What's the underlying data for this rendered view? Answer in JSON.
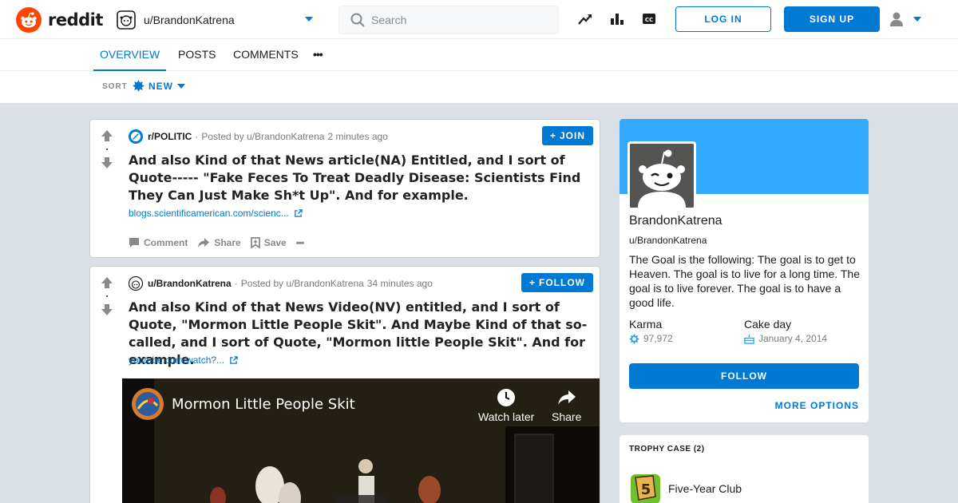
{
  "header": {
    "logo_text": "reddit",
    "current_user": "u/BrandonKatrena",
    "search_placeholder": "Search",
    "login_label": "LOG IN",
    "signup_label": "SIGN UP",
    "icons": [
      "trending-icon",
      "leaderboard-icon",
      "closed-caption-icon",
      "user-avatar-icon"
    ]
  },
  "tabs": [
    {
      "label": "OVERVIEW",
      "active": true
    },
    {
      "label": "POSTS"
    },
    {
      "label": "COMMENTS"
    },
    {
      "label": "•••"
    }
  ],
  "sort": {
    "label": "SORT",
    "selected": "NEW"
  },
  "posts": [
    {
      "subreddit": "r/POLITIC",
      "posted_by": "Posted by u/BrandonKatrena",
      "time": "2 minutes ago",
      "title": "And also Kind of that News article(NA) Entitled, and I sort of Quote----- \"Fake Feces To Treat Deadly Disease: Scientists Find They Can Just Make Sh*t Up\". And for example.",
      "link": "blogs.scientificamerican.com/scienc...",
      "join_label": "JOIN",
      "actions": {
        "comment": "Comment",
        "share": "Share",
        "save": "Save"
      }
    },
    {
      "subreddit": "u/BrandonKatrena",
      "posted_by": "Posted by u/BrandonKatrena",
      "time": "34 minutes ago",
      "title": "And also Kind of that News Video(NV) entitled, and I sort of Quote, \"Mormon Little People Skit\". And Maybe Kind of that so-called, and I sort of Quote, \"Mormon little People Skit\". And for example.",
      "link": "youtube.com/watch?...",
      "follow_label": "FOLLOW",
      "video": {
        "title": "Mormon Little People Skit",
        "watch_later": "Watch later",
        "share": "Share"
      }
    }
  ],
  "profile": {
    "display_name": "BrandonKatrena",
    "handle": "u/BrandonKatrena",
    "bio": "The Goal is the following: The goal is to get to Heaven. The goal is to live for a long time. The goal is to live forever. The goal is to have a good life.",
    "karma_label": "Karma",
    "karma_value": "97,972",
    "cakeday_label": "Cake day",
    "cakeday_value": "January 4, 2014",
    "follow_label": "FOLLOW",
    "more_options": "MORE OPTIONS"
  },
  "trophy_case": {
    "title": "TROPHY CASE (2)",
    "items": [
      {
        "name": "Five-Year Club"
      }
    ]
  },
  "colors": {
    "brand": "#ff4500",
    "accent": "#0079d3",
    "banner": "#33a8ff",
    "background": "#dae0e6"
  }
}
